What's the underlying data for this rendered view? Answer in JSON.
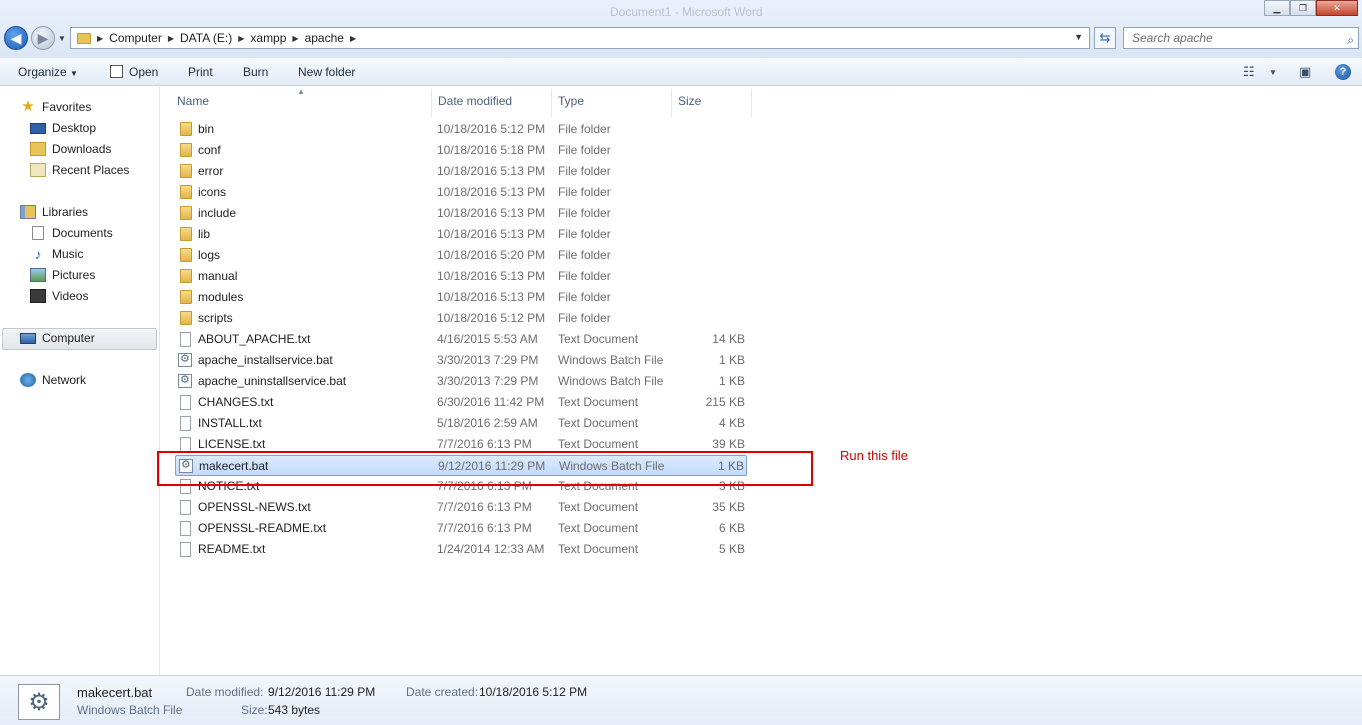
{
  "window": {
    "title": "Document1 - Microsoft Word"
  },
  "address": {
    "crumbs": [
      "Computer",
      "DATA (E:)",
      "xampp",
      "apache"
    ],
    "search_placeholder": "Search apache"
  },
  "toolbar": {
    "organize": "Organize",
    "open": "Open",
    "print": "Print",
    "burn": "Burn",
    "new_folder": "New folder"
  },
  "nav": {
    "favorites": "Favorites",
    "desktop": "Desktop",
    "downloads": "Downloads",
    "recent": "Recent Places",
    "libraries": "Libraries",
    "documents": "Documents",
    "music": "Music",
    "pictures": "Pictures",
    "videos": "Videos",
    "computer": "Computer",
    "network": "Network"
  },
  "columns": {
    "name": "Name",
    "date": "Date modified",
    "type": "Type",
    "size": "Size"
  },
  "files": [
    {
      "name": "bin",
      "date": "10/18/2016 5:12 PM",
      "type": "File folder",
      "size": "",
      "kind": "folder"
    },
    {
      "name": "conf",
      "date": "10/18/2016 5:18 PM",
      "type": "File folder",
      "size": "",
      "kind": "folder"
    },
    {
      "name": "error",
      "date": "10/18/2016 5:13 PM",
      "type": "File folder",
      "size": "",
      "kind": "folder"
    },
    {
      "name": "icons",
      "date": "10/18/2016 5:13 PM",
      "type": "File folder",
      "size": "",
      "kind": "folder"
    },
    {
      "name": "include",
      "date": "10/18/2016 5:13 PM",
      "type": "File folder",
      "size": "",
      "kind": "folder"
    },
    {
      "name": "lib",
      "date": "10/18/2016 5:13 PM",
      "type": "File folder",
      "size": "",
      "kind": "folder"
    },
    {
      "name": "logs",
      "date": "10/18/2016 5:20 PM",
      "type": "File folder",
      "size": "",
      "kind": "folder"
    },
    {
      "name": "manual",
      "date": "10/18/2016 5:13 PM",
      "type": "File folder",
      "size": "",
      "kind": "folder"
    },
    {
      "name": "modules",
      "date": "10/18/2016 5:13 PM",
      "type": "File folder",
      "size": "",
      "kind": "folder"
    },
    {
      "name": "scripts",
      "date": "10/18/2016 5:12 PM",
      "type": "File folder",
      "size": "",
      "kind": "folder"
    },
    {
      "name": "ABOUT_APACHE.txt",
      "date": "4/16/2015 5:53 AM",
      "type": "Text Document",
      "size": "14 KB",
      "kind": "text"
    },
    {
      "name": "apache_installservice.bat",
      "date": "3/30/2013 7:29 PM",
      "type": "Windows Batch File",
      "size": "1 KB",
      "kind": "bat"
    },
    {
      "name": "apache_uninstallservice.bat",
      "date": "3/30/2013 7:29 PM",
      "type": "Windows Batch File",
      "size": "1 KB",
      "kind": "bat"
    },
    {
      "name": "CHANGES.txt",
      "date": "6/30/2016 11:42 PM",
      "type": "Text Document",
      "size": "215 KB",
      "kind": "text"
    },
    {
      "name": "INSTALL.txt",
      "date": "5/18/2016 2:59 AM",
      "type": "Text Document",
      "size": "4 KB",
      "kind": "text"
    },
    {
      "name": "LICENSE.txt",
      "date": "7/7/2016 6:13 PM",
      "type": "Text Document",
      "size": "39 KB",
      "kind": "text"
    },
    {
      "name": "makecert.bat",
      "date": "9/12/2016 11:29 PM",
      "type": "Windows Batch File",
      "size": "1 KB",
      "kind": "bat",
      "selected": true
    },
    {
      "name": "NOTICE.txt",
      "date": "7/7/2016 6:13 PM",
      "type": "Text Document",
      "size": "3 KB",
      "kind": "text"
    },
    {
      "name": "OPENSSL-NEWS.txt",
      "date": "7/7/2016 6:13 PM",
      "type": "Text Document",
      "size": "35 KB",
      "kind": "text"
    },
    {
      "name": "OPENSSL-README.txt",
      "date": "7/7/2016 6:13 PM",
      "type": "Text Document",
      "size": "6 KB",
      "kind": "text"
    },
    {
      "name": "README.txt",
      "date": "1/24/2014 12:33 AM",
      "type": "Text Document",
      "size": "5 KB",
      "kind": "text"
    }
  ],
  "annotation": "Run this file",
  "details": {
    "name": "makecert.bat",
    "type": "Windows Batch File",
    "modified_label": "Date modified:",
    "modified_value": "9/12/2016 11:29 PM",
    "created_label": "Date created:",
    "created_value": "10/18/2016 5:12 PM",
    "size_label": "Size:",
    "size_value": "543 bytes"
  },
  "colors": {
    "annotation": "#d30000",
    "selection": "#c1dbfc"
  }
}
